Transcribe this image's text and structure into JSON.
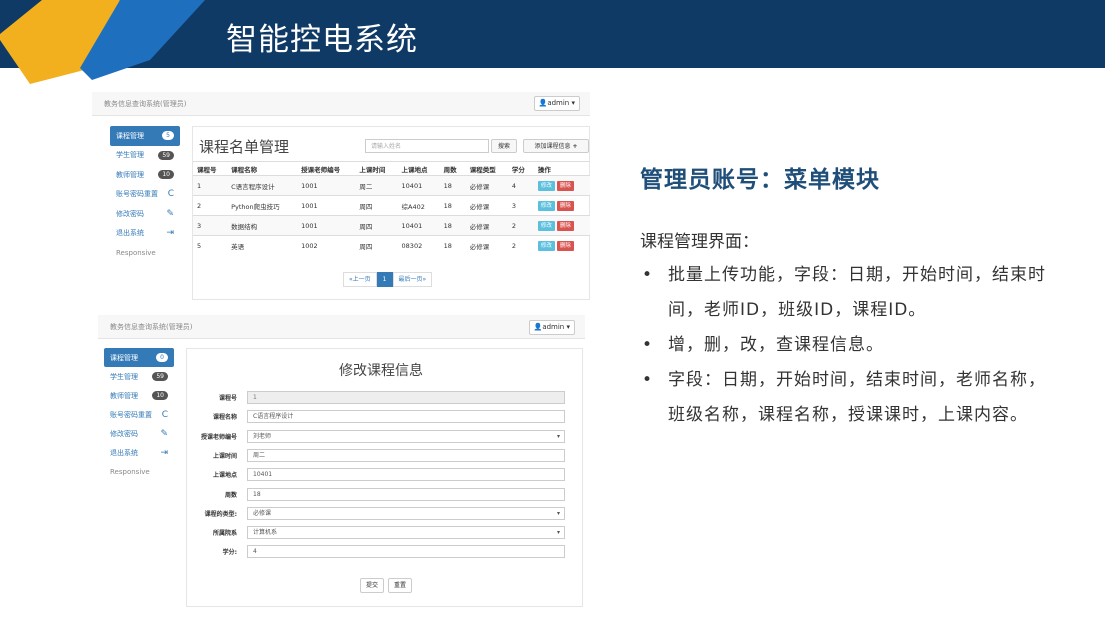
{
  "slide": {
    "title": "智能控电系统"
  },
  "top_shot": {
    "brand": "教务信息查询系统(管理员)",
    "admin_label": "admin",
    "sidebar": [
      {
        "label": "课程管理",
        "badge": "5",
        "active": true
      },
      {
        "label": "学生管理",
        "badge": "59"
      },
      {
        "label": "教师管理",
        "badge": "10"
      },
      {
        "label": "账号密码重置",
        "icon": "C"
      },
      {
        "label": "修改密码",
        "icon": "✎"
      },
      {
        "label": "退出系统",
        "icon": "⇥"
      },
      {
        "label": "Responsive"
      }
    ],
    "panel_title": "课程名单管理",
    "search_placeholder": "请输入姓名",
    "search_button": "搜索",
    "add_button": "添加课程信息",
    "columns": [
      "课程号",
      "课程名称",
      "授课老师编号",
      "上课时间",
      "上课地点",
      "周数",
      "课程类型",
      "学分",
      "操作"
    ],
    "rows": [
      [
        "1",
        "C语言程序设计",
        "1001",
        "周二",
        "10401",
        "18",
        "必修课",
        "4"
      ],
      [
        "2",
        "Python爬虫技巧",
        "1001",
        "周四",
        "综A402",
        "18",
        "必修课",
        "3"
      ],
      [
        "3",
        "数据结构",
        "1001",
        "周四",
        "10401",
        "18",
        "必修课",
        "2"
      ],
      [
        "5",
        "英语",
        "1002",
        "周四",
        "08302",
        "18",
        "必修课",
        "2"
      ]
    ],
    "edit_label": "修改",
    "delete_label": "删除",
    "pagination": [
      "«上一页",
      "1",
      "最后一页»"
    ]
  },
  "bottom_shot": {
    "brand": "教务信息查询系统(管理员)",
    "admin_label": "admin",
    "sidebar": [
      {
        "label": "课程管理",
        "badge": "0",
        "active": true
      },
      {
        "label": "学生管理",
        "badge": "59"
      },
      {
        "label": "教师管理",
        "badge": "10"
      },
      {
        "label": "账号密码重置",
        "icon": "C"
      },
      {
        "label": "修改密码",
        "icon": "✎"
      },
      {
        "label": "退出系统",
        "icon": "⇥"
      },
      {
        "label": "Responsive"
      }
    ],
    "form_title": "修改课程信息",
    "fields": [
      {
        "label": "课程号",
        "value": "1",
        "readonly": true
      },
      {
        "label": "课程名称",
        "value": "C语言程序设计"
      },
      {
        "label": "授课老师编号",
        "value": "刘老师",
        "select": true
      },
      {
        "label": "上课时间",
        "value": "周二"
      },
      {
        "label": "上课地点",
        "value": "10401"
      },
      {
        "label": "周数",
        "value": "18"
      },
      {
        "label": "课程的类型:",
        "value": "必修课",
        "select": true
      },
      {
        "label": "所属院系",
        "value": "计算机系",
        "select": true
      },
      {
        "label": "学分:",
        "value": "4"
      }
    ],
    "submit": "提交",
    "reset": "重置"
  },
  "right": {
    "heading": "管理员账号：菜单模块",
    "subtitle": "课程管理界面：",
    "bullets": [
      "批量上传功能，字段：日期，开始时间，结束时间，老师ID，班级ID，课程ID。",
      "增，删，改，查课程信息。",
      "字段：日期，开始时间，结束时间，老师名称，班级名称，课程名称，授课课时，上课内容。"
    ]
  },
  "colors": {
    "header_bg": "#0f3a66",
    "accent_yellow": "#f2b01e",
    "accent_blue": "#1f6fbf",
    "heading_blue": "#1f4e79",
    "bootstrap_primary": "#337ab7"
  }
}
